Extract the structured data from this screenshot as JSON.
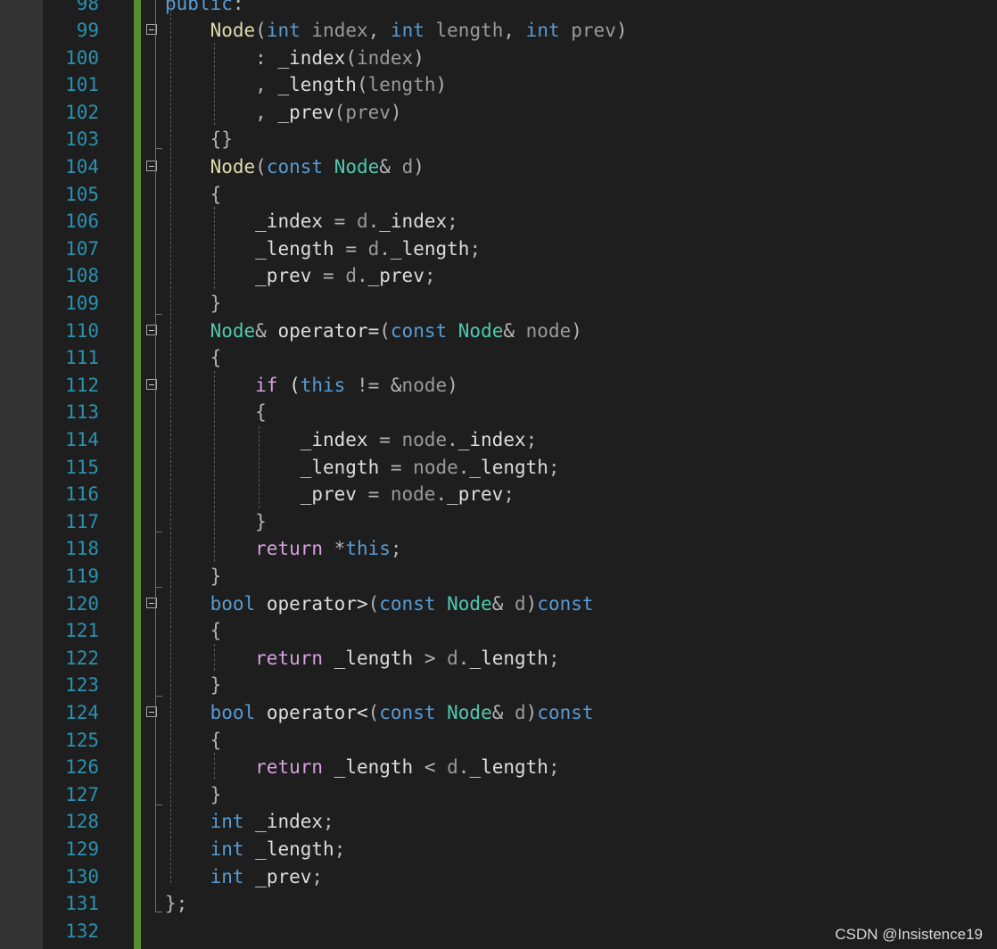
{
  "editor": {
    "lines": [
      {
        "num": "98",
        "fold": false,
        "tokens": [
          {
            "t": "public",
            "c": "kw"
          },
          {
            "t": ":",
            "c": "punc"
          }
        ]
      },
      {
        "num": "99",
        "fold": true,
        "tokens": [
          {
            "t": "    "
          },
          {
            "t": "Node",
            "c": "fn"
          },
          {
            "t": "(",
            "c": "punc"
          },
          {
            "t": "int",
            "c": "kw"
          },
          {
            "t": " "
          },
          {
            "t": "index",
            "c": "param"
          },
          {
            "t": ", ",
            "c": "punc"
          },
          {
            "t": "int",
            "c": "kw"
          },
          {
            "t": " "
          },
          {
            "t": "length",
            "c": "param"
          },
          {
            "t": ", ",
            "c": "punc"
          },
          {
            "t": "int",
            "c": "kw"
          },
          {
            "t": " "
          },
          {
            "t": "prev",
            "c": "param"
          },
          {
            "t": ")",
            "c": "punc"
          }
        ]
      },
      {
        "num": "100",
        "fold": false,
        "tokens": [
          {
            "t": "        "
          },
          {
            "t": ": ",
            "c": "punc"
          },
          {
            "t": "_index",
            "c": "id"
          },
          {
            "t": "(",
            "c": "punc"
          },
          {
            "t": "index",
            "c": "param"
          },
          {
            "t": ")",
            "c": "punc"
          }
        ]
      },
      {
        "num": "101",
        "fold": false,
        "tokens": [
          {
            "t": "        "
          },
          {
            "t": ", ",
            "c": "punc"
          },
          {
            "t": "_length",
            "c": "id"
          },
          {
            "t": "(",
            "c": "punc"
          },
          {
            "t": "length",
            "c": "param"
          },
          {
            "t": ")",
            "c": "punc"
          }
        ]
      },
      {
        "num": "102",
        "fold": false,
        "tokens": [
          {
            "t": "        "
          },
          {
            "t": ", ",
            "c": "punc"
          },
          {
            "t": "_prev",
            "c": "id"
          },
          {
            "t": "(",
            "c": "punc"
          },
          {
            "t": "prev",
            "c": "param"
          },
          {
            "t": ")",
            "c": "punc"
          }
        ]
      },
      {
        "num": "103",
        "fold": false,
        "tokens": [
          {
            "t": "    "
          },
          {
            "t": "{}",
            "c": "punc"
          }
        ]
      },
      {
        "num": "104",
        "fold": true,
        "tokens": [
          {
            "t": "    "
          },
          {
            "t": "Node",
            "c": "fn"
          },
          {
            "t": "(",
            "c": "punc"
          },
          {
            "t": "const",
            "c": "kw"
          },
          {
            "t": " "
          },
          {
            "t": "Node",
            "c": "type"
          },
          {
            "t": "& ",
            "c": "op"
          },
          {
            "t": "d",
            "c": "param"
          },
          {
            "t": ")",
            "c": "punc"
          }
        ]
      },
      {
        "num": "105",
        "fold": false,
        "tokens": [
          {
            "t": "    "
          },
          {
            "t": "{",
            "c": "punc"
          }
        ]
      },
      {
        "num": "106",
        "fold": false,
        "tokens": [
          {
            "t": "        "
          },
          {
            "t": "_index",
            "c": "id"
          },
          {
            "t": " = ",
            "c": "op"
          },
          {
            "t": "d",
            "c": "param"
          },
          {
            "t": ".",
            "c": "punc"
          },
          {
            "t": "_index",
            "c": "id"
          },
          {
            "t": ";",
            "c": "punc"
          }
        ]
      },
      {
        "num": "107",
        "fold": false,
        "tokens": [
          {
            "t": "        "
          },
          {
            "t": "_length",
            "c": "id"
          },
          {
            "t": " = ",
            "c": "op"
          },
          {
            "t": "d",
            "c": "param"
          },
          {
            "t": ".",
            "c": "punc"
          },
          {
            "t": "_length",
            "c": "id"
          },
          {
            "t": ";",
            "c": "punc"
          }
        ]
      },
      {
        "num": "108",
        "fold": false,
        "tokens": [
          {
            "t": "        "
          },
          {
            "t": "_prev",
            "c": "id"
          },
          {
            "t": " = ",
            "c": "op"
          },
          {
            "t": "d",
            "c": "param"
          },
          {
            "t": ".",
            "c": "punc"
          },
          {
            "t": "_prev",
            "c": "id"
          },
          {
            "t": ";",
            "c": "punc"
          }
        ]
      },
      {
        "num": "109",
        "fold": false,
        "tokens": [
          {
            "t": "    "
          },
          {
            "t": "}",
            "c": "punc"
          }
        ]
      },
      {
        "num": "110",
        "fold": true,
        "tokens": [
          {
            "t": "    "
          },
          {
            "t": "Node",
            "c": "type"
          },
          {
            "t": "& ",
            "c": "op"
          },
          {
            "t": "operator=",
            "c": "id"
          },
          {
            "t": "(",
            "c": "punc"
          },
          {
            "t": "const",
            "c": "kw"
          },
          {
            "t": " "
          },
          {
            "t": "Node",
            "c": "type"
          },
          {
            "t": "& ",
            "c": "op"
          },
          {
            "t": "node",
            "c": "param"
          },
          {
            "t": ")",
            "c": "punc"
          }
        ]
      },
      {
        "num": "111",
        "fold": false,
        "tokens": [
          {
            "t": "    "
          },
          {
            "t": "{",
            "c": "punc"
          }
        ]
      },
      {
        "num": "112",
        "fold": true,
        "tokens": [
          {
            "t": "        "
          },
          {
            "t": "if",
            "c": "ctl"
          },
          {
            "t": " ("
          },
          {
            "t": "this",
            "c": "kw"
          },
          {
            "t": " != &",
            "c": "op"
          },
          {
            "t": "node",
            "c": "param"
          },
          {
            "t": ")",
            "c": "punc"
          }
        ]
      },
      {
        "num": "113",
        "fold": false,
        "tokens": [
          {
            "t": "        "
          },
          {
            "t": "{",
            "c": "punc"
          }
        ]
      },
      {
        "num": "114",
        "fold": false,
        "tokens": [
          {
            "t": "            "
          },
          {
            "t": "_index",
            "c": "id"
          },
          {
            "t": " = ",
            "c": "op"
          },
          {
            "t": "node",
            "c": "param"
          },
          {
            "t": ".",
            "c": "punc"
          },
          {
            "t": "_index",
            "c": "id"
          },
          {
            "t": ";",
            "c": "punc"
          }
        ]
      },
      {
        "num": "115",
        "fold": false,
        "tokens": [
          {
            "t": "            "
          },
          {
            "t": "_length",
            "c": "id"
          },
          {
            "t": " = ",
            "c": "op"
          },
          {
            "t": "node",
            "c": "param"
          },
          {
            "t": ".",
            "c": "punc"
          },
          {
            "t": "_length",
            "c": "id"
          },
          {
            "t": ";",
            "c": "punc"
          }
        ]
      },
      {
        "num": "116",
        "fold": false,
        "tokens": [
          {
            "t": "            "
          },
          {
            "t": "_prev",
            "c": "id"
          },
          {
            "t": " = ",
            "c": "op"
          },
          {
            "t": "node",
            "c": "param"
          },
          {
            "t": ".",
            "c": "punc"
          },
          {
            "t": "_prev",
            "c": "id"
          },
          {
            "t": ";",
            "c": "punc"
          }
        ]
      },
      {
        "num": "117",
        "fold": false,
        "tokens": [
          {
            "t": "        "
          },
          {
            "t": "}",
            "c": "punc"
          }
        ]
      },
      {
        "num": "118",
        "fold": false,
        "tokens": [
          {
            "t": "        "
          },
          {
            "t": "return",
            "c": "ctl"
          },
          {
            "t": " *",
            "c": "op"
          },
          {
            "t": "this",
            "c": "kw"
          },
          {
            "t": ";",
            "c": "punc"
          }
        ]
      },
      {
        "num": "119",
        "fold": false,
        "tokens": [
          {
            "t": "    "
          },
          {
            "t": "}",
            "c": "punc"
          }
        ]
      },
      {
        "num": "120",
        "fold": true,
        "tokens": [
          {
            "t": "    "
          },
          {
            "t": "bool",
            "c": "kw"
          },
          {
            "t": " "
          },
          {
            "t": "operator>",
            "c": "id"
          },
          {
            "t": "(",
            "c": "punc"
          },
          {
            "t": "const",
            "c": "kw"
          },
          {
            "t": " "
          },
          {
            "t": "Node",
            "c": "type"
          },
          {
            "t": "& ",
            "c": "op"
          },
          {
            "t": "d",
            "c": "param"
          },
          {
            "t": ")",
            "c": "punc"
          },
          {
            "t": "const",
            "c": "kw"
          }
        ]
      },
      {
        "num": "121",
        "fold": false,
        "tokens": [
          {
            "t": "    "
          },
          {
            "t": "{",
            "c": "punc"
          }
        ]
      },
      {
        "num": "122",
        "fold": false,
        "tokens": [
          {
            "t": "        "
          },
          {
            "t": "return",
            "c": "ctl"
          },
          {
            "t": " "
          },
          {
            "t": "_length",
            "c": "id"
          },
          {
            "t": " > ",
            "c": "op"
          },
          {
            "t": "d",
            "c": "param"
          },
          {
            "t": ".",
            "c": "punc"
          },
          {
            "t": "_length",
            "c": "id"
          },
          {
            "t": ";",
            "c": "punc"
          }
        ]
      },
      {
        "num": "123",
        "fold": false,
        "tokens": [
          {
            "t": "    "
          },
          {
            "t": "}",
            "c": "punc"
          }
        ]
      },
      {
        "num": "124",
        "fold": true,
        "tokens": [
          {
            "t": "    "
          },
          {
            "t": "bool",
            "c": "kw"
          },
          {
            "t": " "
          },
          {
            "t": "operator<",
            "c": "id"
          },
          {
            "t": "(",
            "c": "punc"
          },
          {
            "t": "const",
            "c": "kw"
          },
          {
            "t": " "
          },
          {
            "t": "Node",
            "c": "type"
          },
          {
            "t": "& ",
            "c": "op"
          },
          {
            "t": "d",
            "c": "param"
          },
          {
            "t": ")",
            "c": "punc"
          },
          {
            "t": "const",
            "c": "kw"
          }
        ]
      },
      {
        "num": "125",
        "fold": false,
        "tokens": [
          {
            "t": "    "
          },
          {
            "t": "{",
            "c": "punc"
          }
        ]
      },
      {
        "num": "126",
        "fold": false,
        "tokens": [
          {
            "t": "        "
          },
          {
            "t": "return",
            "c": "ctl"
          },
          {
            "t": " "
          },
          {
            "t": "_length",
            "c": "id"
          },
          {
            "t": " < ",
            "c": "op"
          },
          {
            "t": "d",
            "c": "param"
          },
          {
            "t": ".",
            "c": "punc"
          },
          {
            "t": "_length",
            "c": "id"
          },
          {
            "t": ";",
            "c": "punc"
          }
        ]
      },
      {
        "num": "127",
        "fold": false,
        "tokens": [
          {
            "t": "    "
          },
          {
            "t": "}",
            "c": "punc"
          }
        ]
      },
      {
        "num": "128",
        "fold": false,
        "tokens": [
          {
            "t": "    "
          },
          {
            "t": "int",
            "c": "kw"
          },
          {
            "t": " "
          },
          {
            "t": "_index",
            "c": "id"
          },
          {
            "t": ";",
            "c": "punc"
          }
        ]
      },
      {
        "num": "129",
        "fold": false,
        "tokens": [
          {
            "t": "    "
          },
          {
            "t": "int",
            "c": "kw"
          },
          {
            "t": " "
          },
          {
            "t": "_length",
            "c": "id"
          },
          {
            "t": ";",
            "c": "punc"
          }
        ]
      },
      {
        "num": "130",
        "fold": false,
        "tokens": [
          {
            "t": "    "
          },
          {
            "t": "int",
            "c": "kw"
          },
          {
            "t": " "
          },
          {
            "t": "_prev",
            "c": "id"
          },
          {
            "t": ";",
            "c": "punc"
          }
        ]
      },
      {
        "num": "131",
        "fold": false,
        "tokens": [
          {
            "t": "};",
            "c": "punc"
          }
        ]
      },
      {
        "num": "132",
        "fold": false,
        "tokens": []
      }
    ]
  },
  "watermark": "CSDN @Insistence19",
  "colors": {
    "background": "#1e1e1e",
    "line_number": "#2b91af",
    "change_bar": "#5a8d2f",
    "keyword": "#569cd6",
    "control": "#d8a0df",
    "type": "#4ec9b0",
    "function": "#dcdcaa",
    "parameter": "#9a9a9a",
    "identifier": "#dcdcdc"
  },
  "icons": {
    "fold": "collapse-minus-icon"
  }
}
